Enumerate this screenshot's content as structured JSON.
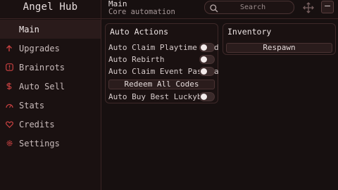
{
  "app": {
    "title": "Angel Hub"
  },
  "header": {
    "title": "Main",
    "subtitle": "Core automation"
  },
  "search": {
    "placeholder": "Search"
  },
  "sidebar": {
    "items": [
      {
        "label": "Main",
        "icon": "none",
        "active": true
      },
      {
        "label": "Upgrades",
        "icon": "arrow-up-icon"
      },
      {
        "label": "Brainrots",
        "icon": "alert-icon"
      },
      {
        "label": "Auto Sell",
        "icon": "dollar-icon"
      },
      {
        "label": "Stats",
        "icon": "gauge-icon"
      },
      {
        "label": "Credits",
        "icon": "heart-icon"
      },
      {
        "label": "Settings",
        "icon": "gear-icon"
      }
    ]
  },
  "auto_actions": {
    "title": "Auto Actions",
    "rows": [
      {
        "label": "Auto Claim Playtime Re",
        "suffix": "d",
        "enabled": false
      },
      {
        "label": "Auto Rebirth",
        "enabled": false
      },
      {
        "label": "Auto Claim Event Pass",
        "suffix": "a",
        "enabled": false
      }
    ],
    "redeem_label": "Redeem All Codes",
    "last_row": {
      "label": "Auto Buy Best Luckyblo",
      "enabled": false
    }
  },
  "inventory": {
    "title": "Inventory",
    "respawn_label": "Respawn"
  },
  "colors": {
    "accent": "#c84141",
    "background": "#171010",
    "panel": "#1a1111",
    "border": "#3e2929"
  }
}
